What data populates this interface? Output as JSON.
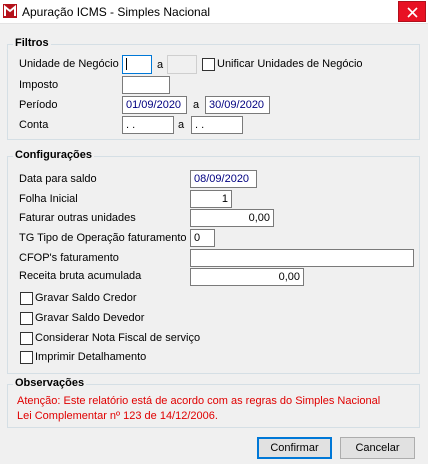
{
  "window": {
    "title": "Apuração ICMS - Simples Nacional"
  },
  "filtros": {
    "legend": "Filtros",
    "unidade_label": "Unidade de Negócio",
    "unidade_from": "",
    "unidade_sep": "a",
    "unidade_to": "",
    "unificar_label": "Unificar Unidades de Negócio",
    "imposto_label": "Imposto",
    "imposto_value": "",
    "periodo_label": "Período",
    "periodo_from": "01/09/2020",
    "periodo_sep": "a",
    "periodo_to": "30/09/2020",
    "conta_label": "Conta",
    "conta_from": " .  .",
    "conta_sep": "a",
    "conta_to": " .  ."
  },
  "config": {
    "legend": "Configurações",
    "data_saldo_label": "Data para saldo",
    "data_saldo_value": "08/09/2020",
    "folha_label": "Folha Inicial",
    "folha_value": "1",
    "faturar_label": "Faturar outras unidades",
    "faturar_value": "0,00",
    "tg_label": "TG Tipo de Operação faturamento",
    "tg_value": "0",
    "cfop_label": "CFOP's faturamento",
    "cfop_value": "",
    "receita_label": "Receita bruta acumulada",
    "receita_value": "0,00",
    "checks": [
      "Gravar Saldo Credor",
      "Gravar Saldo Devedor",
      "Considerar Nota Fiscal de serviço",
      "Imprimir Detalhamento"
    ]
  },
  "obs": {
    "legend": "Observações",
    "line1": "Atenção: Este relatório está de acordo com as regras do Simples Nacional",
    "line2": "Lei Complementar nº 123 de 14/12/2006."
  },
  "buttons": {
    "confirmar": "Confirmar",
    "cancelar": "Cancelar"
  },
  "colors": {
    "close_button": "#e81123",
    "note_text": "#e00000",
    "date_text": "#000080"
  }
}
